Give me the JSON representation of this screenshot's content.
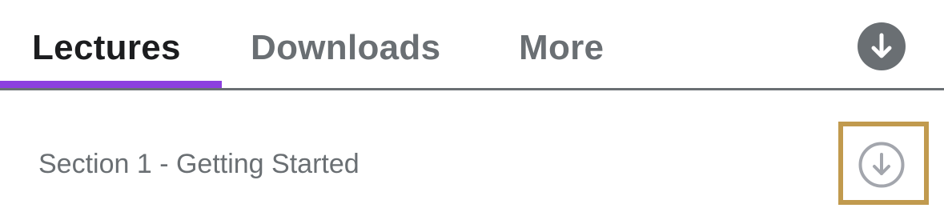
{
  "tabs": [
    {
      "label": "Lectures",
      "active": true
    },
    {
      "label": "Downloads",
      "active": false
    },
    {
      "label": "More",
      "active": false
    }
  ],
  "header": {
    "download_all_icon": "download-arrow-icon"
  },
  "sections": [
    {
      "title": "Section 1 - Getting Started",
      "download_icon": "download-circle-icon"
    }
  ],
  "colors": {
    "accent": "#8c3fdf",
    "active_text": "#1c1d1f",
    "inactive_text": "#6a6f73",
    "highlight": "#c19a4e",
    "icon_outline": "#a3a6ad"
  }
}
